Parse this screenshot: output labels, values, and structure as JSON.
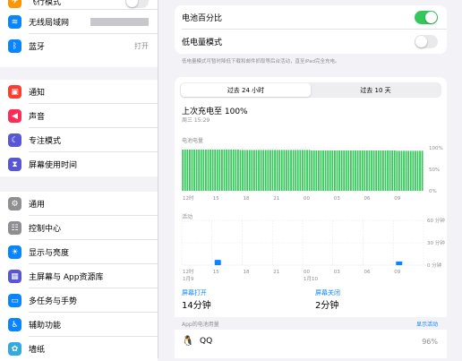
{
  "sidebar": {
    "group1": [
      {
        "label": "飞行模式",
        "icon": "airplane-icon",
        "color": "#ff9500"
      },
      {
        "label": "无线局域网",
        "icon": "wifi-icon",
        "color": "#0a84ff"
      },
      {
        "label": "蓝牙",
        "icon": "bluetooth-icon",
        "color": "#0a84ff",
        "value": "打开"
      }
    ],
    "group2": [
      {
        "label": "通知",
        "icon": "notification-icon",
        "color": "#ff3b30"
      },
      {
        "label": "声音",
        "icon": "sound-icon",
        "color": "#ff2d55"
      },
      {
        "label": "专注模式",
        "icon": "moon-icon",
        "color": "#5856d6"
      },
      {
        "label": "屏幕使用时间",
        "icon": "hourglass-icon",
        "color": "#5856d6"
      }
    ],
    "group3": [
      {
        "label": "通用",
        "icon": "gear-icon",
        "color": "#8e8e93"
      },
      {
        "label": "控制中心",
        "icon": "control-center-icon",
        "color": "#8e8e93"
      },
      {
        "label": "显示与亮度",
        "icon": "display-icon",
        "color": "#0a84ff"
      },
      {
        "label": "主屏幕与 App资源库",
        "icon": "home-screen-icon",
        "color": "#5856d6"
      },
      {
        "label": "多任务与手势",
        "icon": "multitask-icon",
        "color": "#0a84ff"
      },
      {
        "label": "辅助功能",
        "icon": "accessibility-icon",
        "color": "#0a84ff"
      },
      {
        "label": "墙纸",
        "icon": "wallpaper-icon",
        "color": "#34aadc"
      }
    ]
  },
  "settings": {
    "battery_percentage": "电池百分比",
    "low_power_mode": "低电量模式",
    "low_power_footnote": "低电量模式可暂时降低下载和邮件抓取等后台活动，直至iPad完全充电。"
  },
  "usage": {
    "tabs": [
      "过去 24 小时",
      "过去 10 天"
    ],
    "last_charge_title": "上次充电至 100%",
    "last_charge_time": "周三 15:29",
    "battery_level_label": "电池电量",
    "activity_label": "活动",
    "screen_on_label": "屏幕打开",
    "screen_on_value": "14分钟",
    "screen_off_label": "屏幕关闭",
    "screen_off_value": "2分钟",
    "app_usage_label": "App的电池用量",
    "show_activity": "显示活动",
    "app_name": "QQ",
    "app_percent": "96%"
  },
  "colors": {
    "green": "#34c759",
    "blue": "#0a84ff"
  },
  "chart_data": [
    {
      "type": "bar",
      "title": "电池电量",
      "y_ticks": [
        "100%",
        "50%",
        "0%"
      ],
      "ylim": [
        0,
        100
      ],
      "x_ticks": [
        "12时",
        "15",
        "18",
        "21",
        "00",
        "03",
        "06",
        "09"
      ],
      "series": [
        {
          "values": [
            96,
            96,
            96,
            96,
            96,
            96,
            96,
            96,
            96,
            96,
            96,
            96,
            96,
            96,
            96,
            96,
            96,
            96,
            96,
            96,
            96,
            96,
            96,
            96,
            96,
            95,
            95,
            95,
            95,
            95,
            95,
            95,
            95,
            95,
            95,
            95,
            95,
            95,
            95,
            95,
            95,
            95,
            95,
            95,
            95,
            95,
            95,
            95,
            95,
            95,
            95,
            95,
            95,
            95,
            95,
            95,
            94,
            94,
            94,
            94,
            94,
            94,
            94,
            94,
            94,
            94,
            94,
            94,
            94,
            94,
            94,
            94,
            94,
            94,
            94,
            94,
            94,
            94,
            94,
            94,
            94,
            94,
            94,
            94,
            94,
            94,
            94,
            94,
            94,
            94,
            94,
            94,
            94,
            93,
            93,
            93,
            93,
            93,
            93,
            93,
            93,
            93,
            93,
            93,
            93
          ]
        }
      ]
    },
    {
      "type": "bar",
      "title": "活动",
      "y_ticks": [
        "60 分钟",
        "30 分钟",
        "0 分钟"
      ],
      "ylim": [
        0,
        60
      ],
      "x_ticks": [
        "12时",
        "15",
        "18",
        "21",
        "00",
        "03",
        "06",
        "09"
      ],
      "x_sublabels": [
        "1月9",
        "1月10"
      ],
      "bars": [
        {
          "x": "15",
          "value": 7
        },
        {
          "x": "09",
          "value": 5
        }
      ]
    }
  ]
}
